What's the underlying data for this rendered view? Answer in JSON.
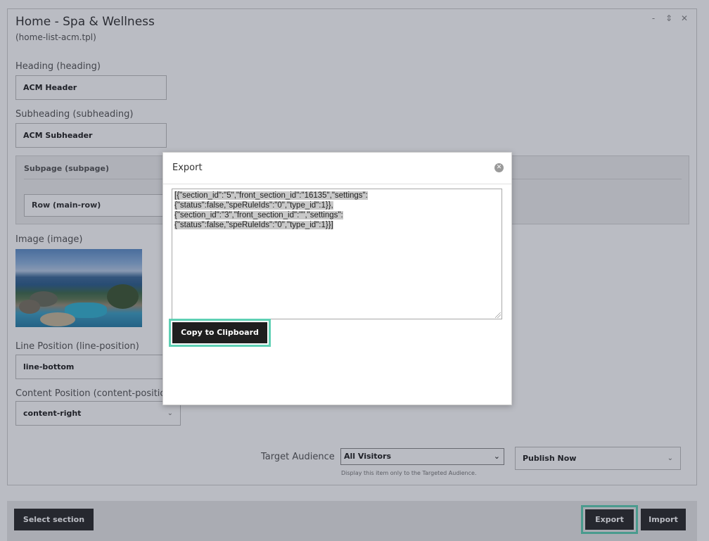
{
  "panel": {
    "title": "Home - Spa & Wellness",
    "template": "(home-list-acm.tpl)",
    "controls": [
      "-",
      "⇕",
      "✕"
    ]
  },
  "fields": {
    "heading_label": "Heading (heading)",
    "heading_value": "ACM Header",
    "subheading_label": "Subheading (subheading)",
    "subheading_value": "ACM Subheader",
    "subpage_label": "Subpage (subpage)",
    "row_value": "Row (main-row)",
    "image_label": "Image (image)",
    "line_position_label": "Line Position (line-position)",
    "line_position_value": "line-bottom",
    "content_position_label": "Content Position (content-position)",
    "content_position_value": "content-right"
  },
  "audience": {
    "label": "Target Audience",
    "selected": "All Visitors",
    "help": "Display this item only to the Targeted Audience.",
    "publish_value": "Publish Now"
  },
  "footer": {
    "select_section": "Select section",
    "export": "Export",
    "import": "Import"
  },
  "modal": {
    "title": "Export",
    "close_icon": "close-circle-icon",
    "json_line1": "[{\"section_id\":\"5\",\"front_section_id\":\"16135\",\"settings\":",
    "json_line2": "{\"status\":false,\"speRuleIds\":\"0\",\"type_id\":1}},",
    "json_line3": "{\"section_id\":\"3\",\"front_section_id\":\"\",\"settings\":",
    "json_line4": "{\"status\":false,\"speRuleIds\":\"0\",\"type_id\":1}}]",
    "copy_button": "Copy to Clipboard"
  },
  "colors": {
    "highlight_border": "#5fd0b4",
    "dark_button": "#2b2b2b",
    "overlay": "rgba(25,32,55,0.30)"
  }
}
